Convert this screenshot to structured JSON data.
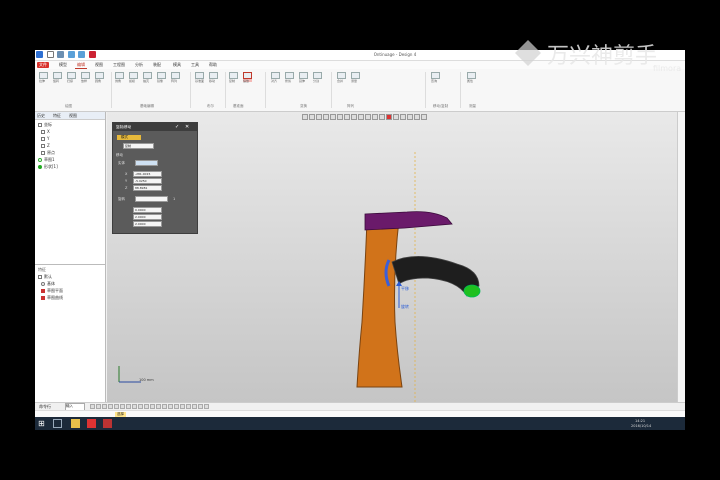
{
  "window": {
    "title": "Ontinuage - Design 4"
  },
  "menu": {
    "tabs": [
      "文件",
      "模型",
      "编辑",
      "视图",
      "工程图",
      "分析",
      "装配",
      "模具",
      "工具",
      "帮助"
    ]
  },
  "ribbon": {
    "groups": [
      "绘图",
      "基础编辑",
      "布尔",
      "基准面",
      "变换",
      "阵列",
      "移动/复制",
      "测量"
    ],
    "buttons": [
      "拉伸",
      "旋转",
      "扫掠",
      "放样",
      "圆角",
      "倒角",
      "拔模",
      "抽壳",
      "镜像",
      "阵列",
      "基准面",
      "移动",
      "复制",
      "缩放",
      "对齐",
      "修剪",
      "延伸",
      "分割",
      "合并",
      "测量",
      "查询",
      "属性"
    ]
  },
  "left_panel": {
    "tabs": [
      "历史",
      "特征",
      "视图"
    ],
    "tree": [
      "坐标",
      "X",
      "Y",
      "Z",
      "原点",
      "草图1",
      "形状[1]"
    ],
    "bottom_title": "特征",
    "bottom_tree": [
      "默认",
      "基体",
      "草图平面",
      "草图曲线"
    ]
  },
  "dialog": {
    "title": "复制/移动",
    "mode_label": "模式",
    "mode_value": "复制",
    "section_move": "移动",
    "entity_label": "实体",
    "field_x_label": "X",
    "field_x": "-281.0015",
    "field_y_label": "Y",
    "field_y": "-5.0250",
    "field_z_label": "Z",
    "field_z": "88.8981",
    "rot_label": "旋转",
    "rot_x": "0.0000",
    "rot_y": "2.0000",
    "rot_z": "2.0000",
    "extra": "1"
  },
  "viewport": {
    "axis_label": "100 mm",
    "annot1": "平移",
    "annot2": "旋转"
  },
  "bottom_bar": {
    "label": "命令行",
    "tab1": "输入",
    "tab2": "选择"
  },
  "taskbar": {
    "time": "14:21",
    "date": "2016/10/14"
  },
  "watermark": {
    "text": "万兴神剪手",
    "sub": "filmora"
  },
  "colors": {
    "accent": "#d9312b",
    "body": "#d1731a",
    "handle": "#6a1a6a",
    "spout": "#1e1e1e",
    "aerator": "#1fc01f"
  }
}
